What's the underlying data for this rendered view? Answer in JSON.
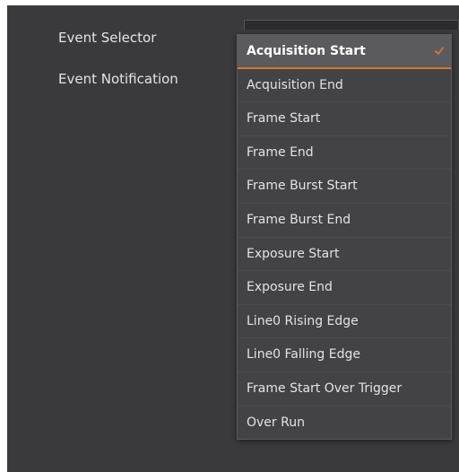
{
  "properties": {
    "event_selector_label": "Event Selector",
    "event_notification_label": "Event Notification"
  },
  "dropdown": {
    "selected_index": 0,
    "items": [
      {
        "label": "Acquisition Start"
      },
      {
        "label": "Acquisition End"
      },
      {
        "label": "Frame Start"
      },
      {
        "label": "Frame End"
      },
      {
        "label": "Frame Burst Start"
      },
      {
        "label": "Frame Burst End"
      },
      {
        "label": "Exposure Start"
      },
      {
        "label": "Exposure End"
      },
      {
        "label": "Line0 Rising Edge"
      },
      {
        "label": "Line0 Falling Edge"
      },
      {
        "label": "Frame Start Over Trigger"
      },
      {
        "label": "Over Run"
      }
    ],
    "selected_icon": "checkmark-icon"
  },
  "colors": {
    "panel_background": "#3a3a3c",
    "dropdown_background": "#434346",
    "selected_item_background": "#5b5b5f",
    "accent": "#d9782f",
    "text": "#e3e3e3"
  }
}
